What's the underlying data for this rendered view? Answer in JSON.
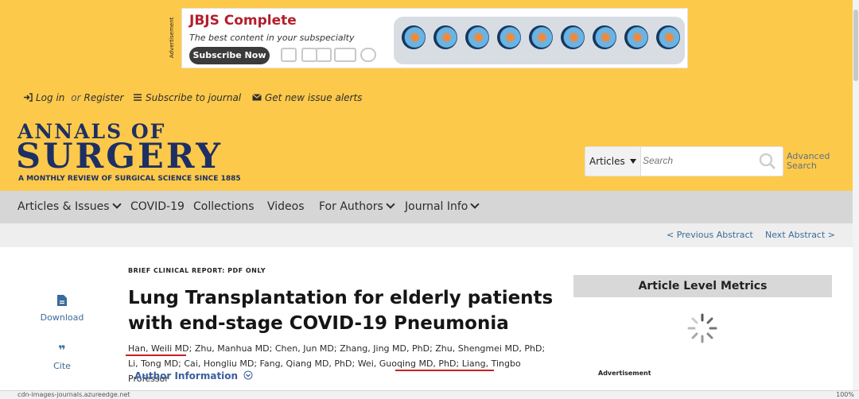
{
  "ad": {
    "label": "Advertisement",
    "title": "JBJS Complete",
    "tagline": "The best content in your subspecialty",
    "button": "Subscribe Now"
  },
  "util": {
    "login": "Log in",
    "or": "or",
    "register": "Register",
    "subscribe": "Subscribe to journal",
    "alerts": "Get new issue alerts"
  },
  "logo": {
    "line1": "ANNALS OF",
    "line2": "SURGERY",
    "tagline": "A MONTHLY REVIEW OF SURGICAL SCIENCE SINCE 1885"
  },
  "search": {
    "scope": "Articles",
    "placeholder": "Search",
    "advanced_line1": "Advanced",
    "advanced_line2": "Search"
  },
  "nav": [
    "Articles & Issues",
    "COVID-19",
    "Collections",
    "Videos",
    "For Authors",
    "Journal Info"
  ],
  "abstract_nav": {
    "prev": "< Previous Abstract",
    "next": "Next Abstract >"
  },
  "left": {
    "download": "Download",
    "cite": "Cite"
  },
  "article": {
    "kicker": "BRIEF CLINICAL REPORT: PDF ONLY",
    "title": "Lung Transplantation for elderly patients with end-stage COVID-19 Pneumonia",
    "authors": [
      "Han, Weili MD",
      "Zhu, Manhua MD",
      "Chen, Jun MD",
      "Zhang, Jing MD, PhD",
      "Zhu, Shengmei MD, PhD",
      "Li, Tong MD",
      "Cai, Hongliu MD",
      "Fang, Qiang MD, PhD",
      "Wei, Guoqing MD, PhD",
      "Liang, Tingbo Professor"
    ],
    "author_info": "Author Information"
  },
  "sidebar": {
    "metrics": "Article Level Metrics",
    "ad_label": "Advertisement"
  },
  "status": {
    "url": "cdn-images-journals.azureedge.net",
    "zoom": "100%"
  },
  "colors": {
    "header": "#fdc94a",
    "navy": "#1e2f63",
    "link": "#3a6b9a",
    "underline": "#c92020"
  }
}
